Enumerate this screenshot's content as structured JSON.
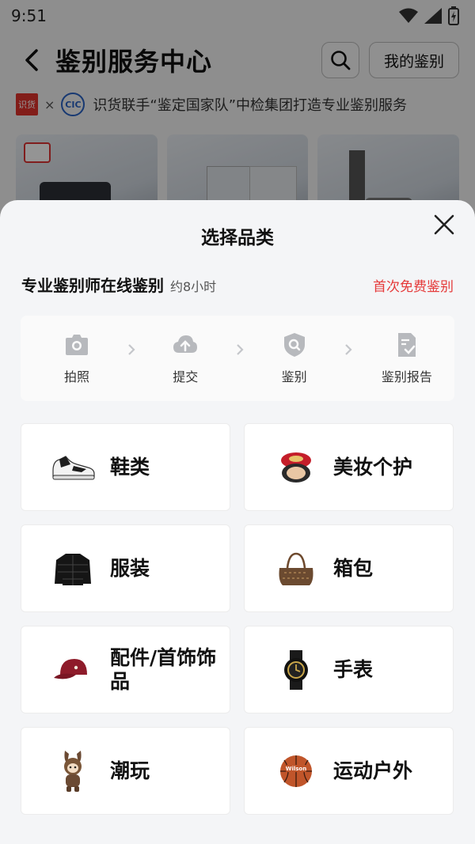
{
  "status_bar": {
    "time": "9:51"
  },
  "header": {
    "title_part1": "鉴",
    "title_part2": "别服务中心",
    "my_button": "我的鉴别"
  },
  "partner": {
    "badge": "识货",
    "times": "×",
    "logo": "CIC",
    "text": "识货联手“鉴定国家队”中检集团打造专业鉴别服务"
  },
  "sheet": {
    "title": "选择品类",
    "info_title": "专业鉴别师在线鉴别",
    "info_time": "约8小时",
    "info_free": "首次免费鉴别",
    "steps": [
      {
        "label": "拍照",
        "icon": "camera-icon"
      },
      {
        "label": "提交",
        "icon": "cloud-upload-icon"
      },
      {
        "label": "鉴别",
        "icon": "shield-search-icon"
      },
      {
        "label": "鉴别报告",
        "icon": "report-check-icon"
      }
    ],
    "categories": [
      {
        "label": "鞋类",
        "icon": "sneaker-icon"
      },
      {
        "label": "美妆个护",
        "icon": "cosmetics-icon"
      },
      {
        "label": "服装",
        "icon": "jacket-icon"
      },
      {
        "label": "箱包",
        "icon": "handbag-icon"
      },
      {
        "label": "配件/首饰饰品",
        "icon": "cap-icon"
      },
      {
        "label": "手表",
        "icon": "watch-icon"
      },
      {
        "label": "潮玩",
        "icon": "toy-icon"
      },
      {
        "label": "运动户外",
        "icon": "basketball-icon"
      }
    ]
  },
  "colors": {
    "accent_red": "#e53a3a",
    "brand_red": "#e0322c",
    "sheet_bg": "#f4f5f7"
  }
}
